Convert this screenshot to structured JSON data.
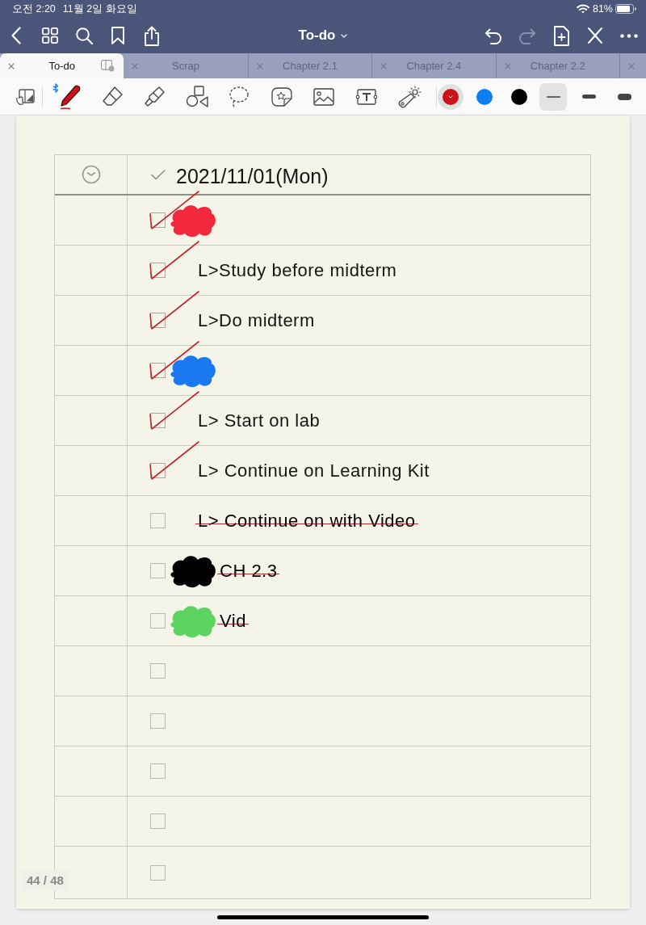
{
  "status_bar": {
    "time": "오전 2:20",
    "date": "11월 2일 화요일",
    "battery": "81%"
  },
  "nav_bar": {
    "title": "To-do",
    "history": [
      {
        "kind": "undo",
        "disabled": false
      },
      {
        "kind": "redo",
        "disabled": true
      }
    ]
  },
  "tabs": [
    {
      "kind": "tab",
      "label": "To-do",
      "selected": true
    },
    {
      "kind": "tab",
      "label": "Scrap",
      "selected": false
    },
    {
      "kind": "tab",
      "label": "Chapter 2.1",
      "selected": false
    },
    {
      "kind": "tab",
      "label": "Chapter 2.4",
      "selected": false
    },
    {
      "kind": "tab",
      "label": "Chapter 2.2",
      "selected": false
    },
    {
      "kind": "clipped",
      "selected": false
    }
  ],
  "toolbar": {
    "tools": [
      {
        "kind": "pen",
        "selected": true
      },
      {
        "kind": "eraser",
        "selected": false
      },
      {
        "kind": "highlighter",
        "selected": false
      },
      {
        "kind": "shapes",
        "selected": false
      },
      {
        "kind": "lasso",
        "selected": false
      },
      {
        "kind": "sticker",
        "selected": false
      },
      {
        "kind": "image",
        "selected": false
      },
      {
        "kind": "text",
        "selected": false
      },
      {
        "kind": "laser",
        "selected": false
      }
    ],
    "colors": [
      {
        "color": "#d01218",
        "selected": true
      },
      {
        "color": "#0a7ff5",
        "selected": false
      },
      {
        "color": "#000000",
        "selected": false
      }
    ],
    "widths": [
      {
        "kind": "thin",
        "selected": true
      },
      {
        "kind": "medium",
        "selected": false
      },
      {
        "kind": "thick",
        "selected": false
      }
    ]
  },
  "page": {
    "header": {
      "date": "2021/11/01(Mon)"
    },
    "rows": [
      {
        "checked": true,
        "scribble": {
          "color": "#f2283c"
        }
      },
      {
        "checked": true,
        "text": "L>Study before midterm",
        "struck": false
      },
      {
        "checked": true,
        "text": "L>Do midterm",
        "struck": false
      },
      {
        "checked": true,
        "scribble": {
          "color": "#1a78f0"
        }
      },
      {
        "checked": true,
        "text": "L> Start on lab",
        "struck": false
      },
      {
        "checked": true,
        "text": "L> Continue on Learning Kit",
        "struck": false
      },
      {
        "checked": false,
        "text": "L> Continue on with Video",
        "struck": true
      },
      {
        "checked": false,
        "scribble": {
          "color": "#000000"
        },
        "text": "CH 2.3",
        "struck": true
      },
      {
        "checked": false,
        "scribble": {
          "color": "#5dd362"
        },
        "text": "Vid",
        "struck": true
      },
      {
        "checked": false
      },
      {
        "checked": false
      },
      {
        "checked": false
      },
      {
        "checked": false
      },
      {
        "checked": false
      }
    ],
    "page_indicator": "44 / 48"
  }
}
